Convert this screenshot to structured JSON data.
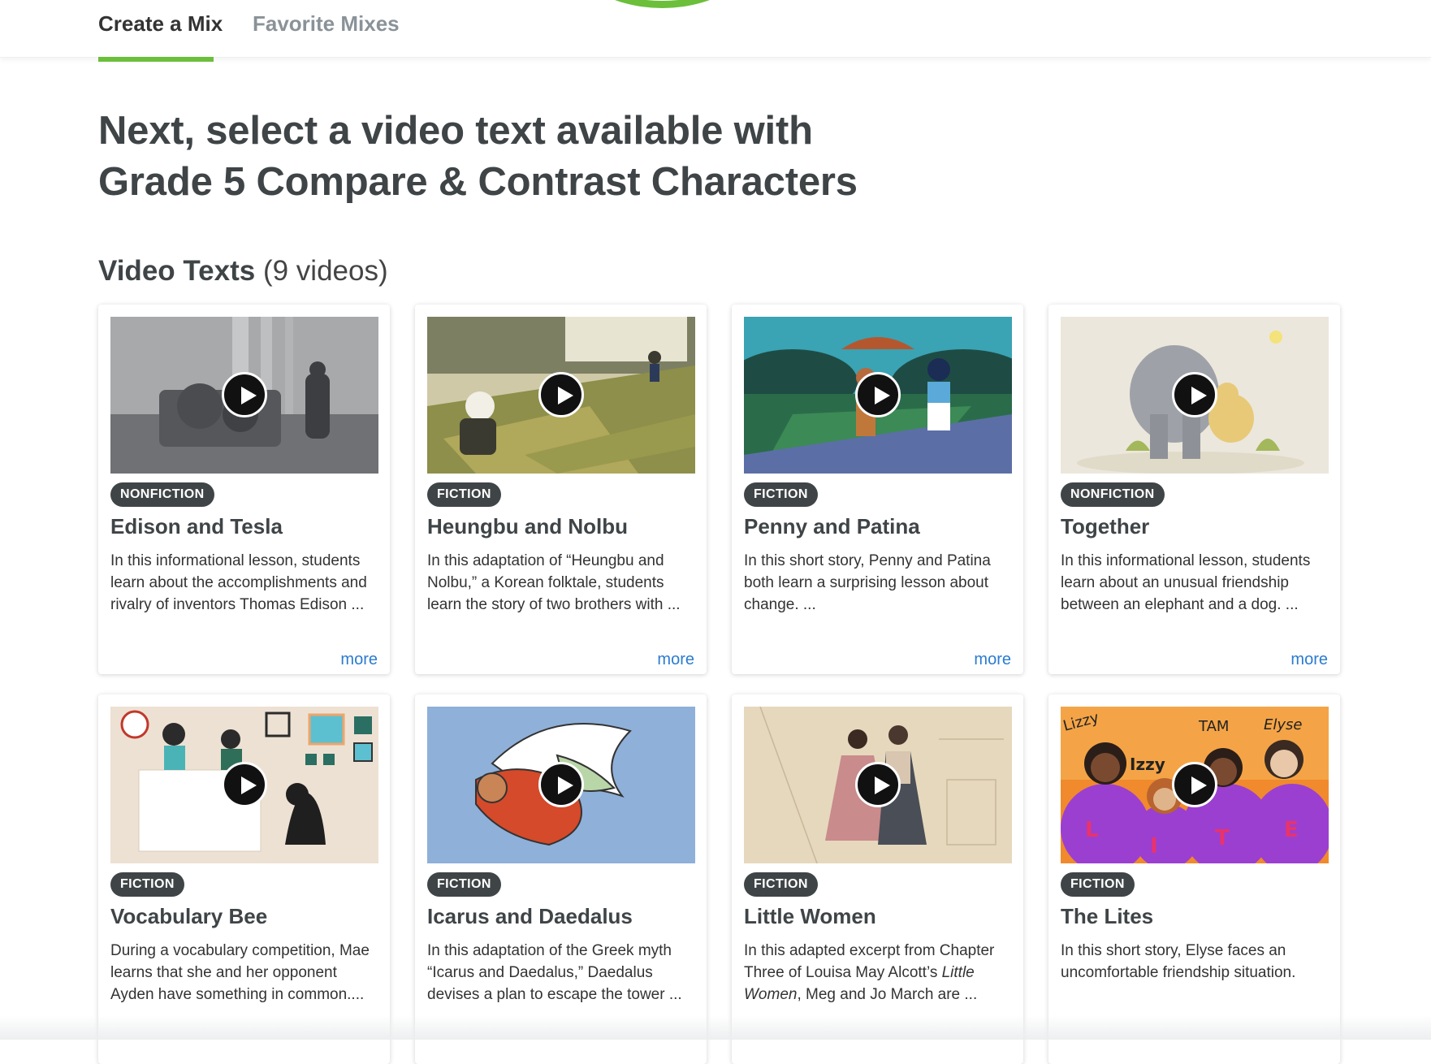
{
  "tabs": {
    "create_mix": "Create a Mix",
    "favorite_mixes": "Favorite Mixes"
  },
  "heading": {
    "line1": "Next, select a video text available with",
    "line2": "Grade 5 Compare & Contrast Characters"
  },
  "section": {
    "title": "Video Texts",
    "count": "(9 videos)"
  },
  "more_label": "more",
  "cards": [
    {
      "genre": "NONFICTION",
      "title": "Edison and Tesla",
      "description": "In this informational lesson, students learn about the accomplishments and rivalry of inventors Thomas Edison ...",
      "has_more": true,
      "thumb_icon": "gears-machine-illustration"
    },
    {
      "genre": "FICTION",
      "title": "Heungbu and Nolbu",
      "description": "In this adaptation of “Heungbu and Nolbu,” a Korean folktale, students learn the story of two brothers with ...",
      "has_more": true,
      "thumb_icon": "korean-village-illustration"
    },
    {
      "genre": "FICTION",
      "title": "Penny and Patina",
      "description": "In this short story, Penny and Patina both learn a surprising lesson about change. ...",
      "has_more": true,
      "thumb_icon": "park-girls-umbrella-illustration"
    },
    {
      "genre": "NONFICTION",
      "title": "Together",
      "description": "In this informational lesson, students learn about an unusual friendship between an elephant and a dog. ...",
      "has_more": true,
      "thumb_icon": "elephant-and-dog-illustration"
    },
    {
      "genre": "FICTION",
      "title": "Vocabulary Bee",
      "description": "During a vocabulary competition, Mae learns that she and her opponent Ayden have something in common....",
      "has_more": false,
      "thumb_icon": "classroom-dog-illustration"
    },
    {
      "genre": "FICTION",
      "title": "Icarus and Daedalus",
      "description": "In this adaptation of the Greek myth “Icarus and Daedalus,” Daedalus devises a plan to escape the tower ...",
      "has_more": false,
      "thumb_icon": "winged-figure-illustration"
    },
    {
      "genre": "FICTION",
      "title": "Little Women",
      "description_pre": "In this adapted excerpt from Chapter Three of Louisa May Alcott’s ",
      "description_em": "Little Women",
      "description_post": ", Meg and Jo March are ...",
      "has_more": false,
      "thumb_icon": "two-sisters-illustration"
    },
    {
      "genre": "FICTION",
      "title": "The Lites",
      "description": "In this short story, Elyse faces an uncomfortable friendship situation.",
      "has_more": false,
      "thumb_icon": "four-girls-lite-illustration",
      "thumb_names": [
        "Lizzy",
        "Izzy",
        "TAM",
        "Elyse"
      ],
      "shirt_letters": [
        "L",
        "I",
        "T",
        "E"
      ]
    }
  ]
}
